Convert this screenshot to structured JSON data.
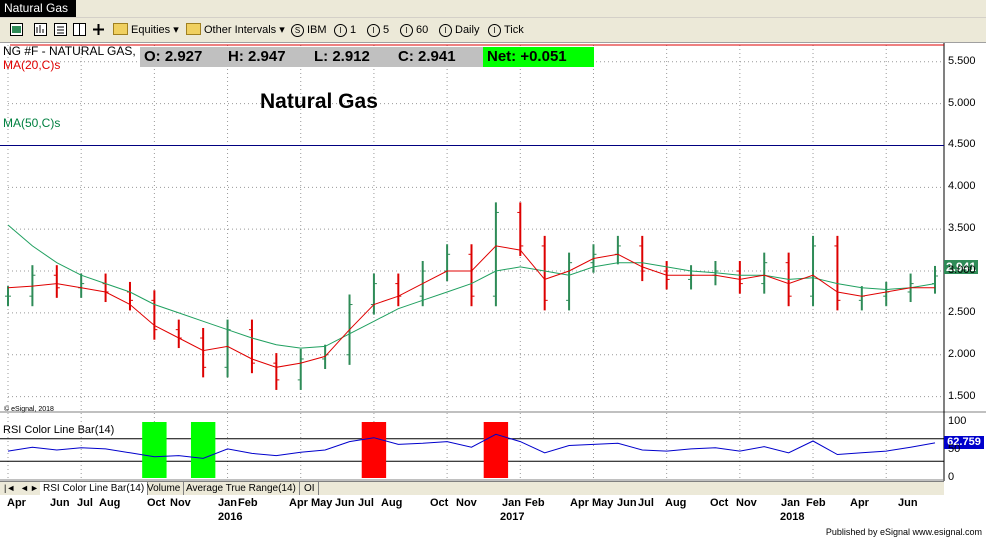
{
  "window": {
    "title": "Natural Gas"
  },
  "toolbar": {
    "equities": "Equities",
    "other_intervals": "Other Intervals",
    "symbol": "IBM",
    "i1": "1",
    "i5": "5",
    "i60": "60",
    "daily": "Daily",
    "tick": "Tick",
    "s_glyph": "S",
    "i_glyph": "I"
  },
  "quote": {
    "open": "O:  2.927",
    "high": "H:  2.947",
    "low": "L:  2.912",
    "close": "C:  2.941",
    "net": "Net:  +0.051"
  },
  "chart": {
    "symbol_label": "NG #F - NATURAL GAS,",
    "ma20_label": "MA(20,C)s",
    "ma50_label": "MA(50,C)s",
    "title": "Natural Gas",
    "watermark": "© eSignal, 2018",
    "last_price": "2.941",
    "rsi_label": "RSI Color Line Bar(14)",
    "rsi_value": "62.759",
    "y_ticks": [
      "5.500",
      "5.000",
      "4.500",
      "4.000",
      "3.500",
      "3.000",
      "2.500",
      "2.000",
      "1.500"
    ],
    "rsi_ticks": [
      "100",
      "50",
      "0"
    ],
    "colors": {
      "up": "#2e8b57",
      "down": "#dd0000",
      "ma20": "#e00000",
      "ma50": "#20a060",
      "rsi": "#0000cc",
      "hline": "#000080"
    }
  },
  "tabs": [
    "RSI Color Line Bar(14)",
    "Volume",
    "Average True Range(14)",
    "OI"
  ],
  "nav": {
    "first": "|◄",
    "prev": "◄",
    "next": "►"
  },
  "xaxis": {
    "months": [
      "Apr",
      "Jun",
      "Jul",
      "Aug",
      "Oct",
      "Nov",
      "Jan",
      "Feb",
      "Apr",
      "May",
      "Jun",
      "Jul",
      "Aug",
      "Oct",
      "Nov",
      "Jan",
      "Feb",
      "Apr",
      "May",
      "Jun",
      "Jul",
      "Aug",
      "Oct",
      "Nov",
      "Jan",
      "Feb",
      "Apr",
      "Jun"
    ],
    "years": [
      "2016",
      "2017",
      "2018"
    ]
  },
  "footer": {
    "published": "Published by eSignal   www.esignal.com"
  },
  "chart_data": {
    "type": "ohlc",
    "title": "Natural Gas",
    "ylim": [
      1.4,
      5.7
    ],
    "series": [
      {
        "name": "MA(20,C)s"
      },
      {
        "name": "MA(50,C)s"
      },
      {
        "name": "RSI Color Line Bar(14)"
      }
    ],
    "close_points": [
      {
        "x": "2015-04",
        "y": 2.7
      },
      {
        "x": "2015-05",
        "y": 2.95
      },
      {
        "x": "2015-06",
        "y": 2.8
      },
      {
        "x": "2015-07",
        "y": 2.85
      },
      {
        "x": "2015-08",
        "y": 2.75
      },
      {
        "x": "2015-09",
        "y": 2.65
      },
      {
        "x": "2015-10",
        "y": 2.3
      },
      {
        "x": "2015-11",
        "y": 2.2
      },
      {
        "x": "2015-12",
        "y": 1.85
      },
      {
        "x": "2016-01",
        "y": 2.3
      },
      {
        "x": "2016-02",
        "y": 1.9
      },
      {
        "x": "2016-03",
        "y": 1.7
      },
      {
        "x": "2016-04",
        "y": 1.95
      },
      {
        "x": "2016-05",
        "y": 2.0
      },
      {
        "x": "2016-06",
        "y": 2.6
      },
      {
        "x": "2016-07",
        "y": 2.85
      },
      {
        "x": "2016-08",
        "y": 2.7
      },
      {
        "x": "2016-09",
        "y": 3.0
      },
      {
        "x": "2016-10",
        "y": 3.2
      },
      {
        "x": "2016-11",
        "y": 2.7
      },
      {
        "x": "2016-12",
        "y": 3.7
      },
      {
        "x": "2017-01",
        "y": 3.3
      },
      {
        "x": "2017-02",
        "y": 2.65
      },
      {
        "x": "2017-03",
        "y": 3.1
      },
      {
        "x": "2017-04",
        "y": 3.2
      },
      {
        "x": "2017-05",
        "y": 3.3
      },
      {
        "x": "2017-06",
        "y": 3.0
      },
      {
        "x": "2017-07",
        "y": 2.9
      },
      {
        "x": "2017-08",
        "y": 2.95
      },
      {
        "x": "2017-09",
        "y": 3.0
      },
      {
        "x": "2017-10",
        "y": 2.85
      },
      {
        "x": "2017-11",
        "y": 3.1
      },
      {
        "x": "2017-12",
        "y": 2.7
      },
      {
        "x": "2018-01",
        "y": 3.3
      },
      {
        "x": "2018-02",
        "y": 2.65
      },
      {
        "x": "2018-03",
        "y": 2.7
      },
      {
        "x": "2018-04",
        "y": 2.75
      },
      {
        "x": "2018-05",
        "y": 2.85
      },
      {
        "x": "2018-06",
        "y": 2.941
      }
    ],
    "ma20": [
      2.8,
      2.82,
      2.85,
      2.8,
      2.75,
      2.6,
      2.35,
      2.2,
      2.05,
      2.1,
      1.95,
      1.85,
      1.9,
      1.98,
      2.3,
      2.6,
      2.7,
      2.85,
      3.0,
      3.0,
      3.3,
      3.25,
      2.9,
      3.0,
      3.15,
      3.2,
      3.05,
      2.95,
      2.95,
      2.95,
      2.9,
      2.95,
      2.85,
      2.95,
      2.75,
      2.7,
      2.75,
      2.8,
      2.8
    ],
    "ma50": [
      3.55,
      3.3,
      3.1,
      2.95,
      2.85,
      2.75,
      2.6,
      2.5,
      2.4,
      2.3,
      2.2,
      2.12,
      2.08,
      2.1,
      2.25,
      2.4,
      2.55,
      2.65,
      2.75,
      2.85,
      3.0,
      3.05,
      3.0,
      2.95,
      3.05,
      3.1,
      3.1,
      3.05,
      3.0,
      2.98,
      2.95,
      2.95,
      2.9,
      2.92,
      2.85,
      2.8,
      2.78,
      2.8,
      2.85
    ],
    "rsi": [
      48,
      55,
      50,
      54,
      52,
      45,
      38,
      40,
      35,
      52,
      44,
      40,
      46,
      50,
      65,
      72,
      60,
      62,
      65,
      55,
      78,
      65,
      45,
      58,
      60,
      62,
      50,
      48,
      52,
      54,
      48,
      56,
      45,
      66,
      42,
      45,
      48,
      55,
      62.759
    ],
    "rsi_ylim": [
      0,
      100
    ],
    "hline": 4.5
  }
}
